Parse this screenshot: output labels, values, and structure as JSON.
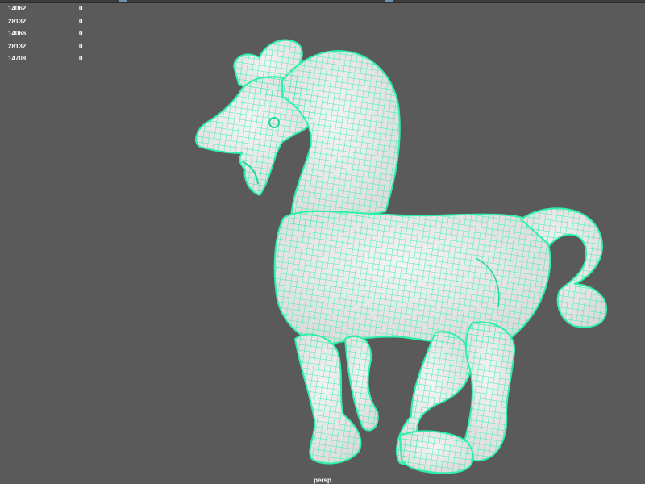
{
  "viewport": {
    "camera": "persp",
    "background": "#5a5a5a",
    "wireframe_color": "#2ef0a8",
    "surface_color": "#ececec"
  },
  "hud_rows": [
    {
      "value": "14062",
      "extra": "0"
    },
    {
      "value": "28132",
      "extra": "0"
    },
    {
      "value": "14066",
      "extra": "0"
    },
    {
      "value": "28132",
      "extra": "0"
    },
    {
      "value": "14708",
      "extra": "0"
    }
  ],
  "model": {
    "icon": "horse-figurine-mesh"
  }
}
